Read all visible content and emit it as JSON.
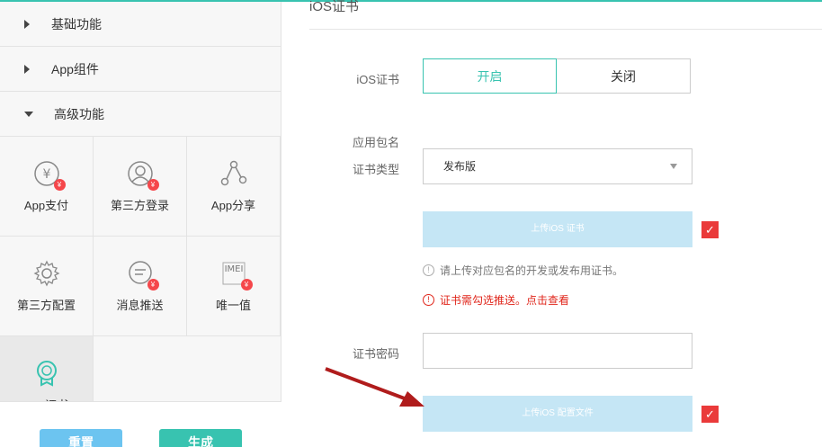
{
  "sidebar": {
    "menu": [
      {
        "label": "基础功能",
        "expanded": false
      },
      {
        "label": "App组件",
        "expanded": false
      },
      {
        "label": "高级功能",
        "expanded": true
      }
    ],
    "features": [
      {
        "label": "App支付",
        "icon": "yuan-icon",
        "badge": "¥"
      },
      {
        "label": "第三方登录",
        "icon": "user-icon",
        "badge": "¥"
      },
      {
        "label": "App分享",
        "icon": "share-icon"
      },
      {
        "label": "第三方配置",
        "icon": "gear-icon"
      },
      {
        "label": "消息推送",
        "icon": "message-icon",
        "badge": "¥"
      },
      {
        "label": "唯一值",
        "icon": "imei-icon",
        "badge": "¥",
        "icon_text": "IMEI"
      },
      {
        "label": "App证书",
        "icon": "certificate-icon"
      }
    ],
    "reset_label": "重置",
    "generate_label": "生成"
  },
  "main": {
    "section_title": "iOS证书",
    "ios_cert_label": "iOS证书",
    "toggle_on": "开启",
    "toggle_off": "关闭",
    "bundle_label": "应用包名",
    "cert_type_label": "证书类型",
    "cert_type_value": "发布版",
    "upload_cert_label": "上传iOS 证书",
    "tip1": "请上传对应包名的开发或发布用证书。",
    "tip2": "证书需勾选推送。点击查看",
    "password_label": "证书密码",
    "password_value": "",
    "upload_profile_label": "上传iOS 配置文件",
    "check_mark": "✓"
  },
  "colors": {
    "accent": "#38c3b0",
    "upload_bg": "#c5e6f5",
    "warn": "#e0261b",
    "check": "#ea3a3a",
    "arrow": "#b01c1c"
  }
}
